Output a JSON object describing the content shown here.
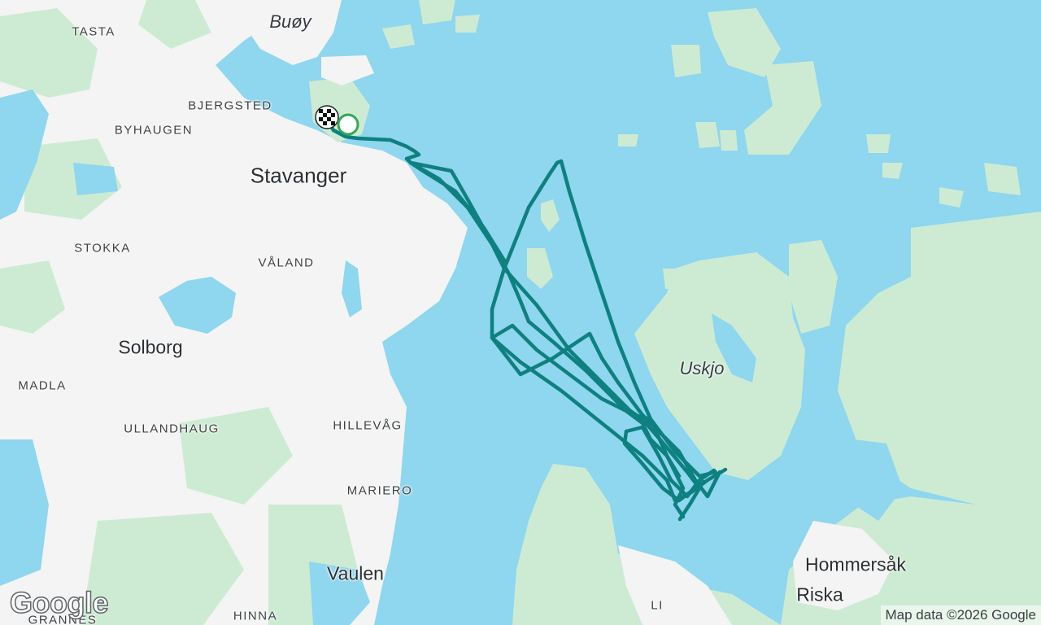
{
  "map": {
    "labels": {
      "tasta": "TASTA",
      "buoy": "Buøy",
      "bjergsted": "BJERGSTED",
      "byhaugen": "BYHAUGEN",
      "stavanger": "Stavanger",
      "stokka": "STOKKA",
      "valand": "VÅLAND",
      "solborg": "Solborg",
      "madla": "MADLA",
      "ullandhaug": "ULLANDHAUG",
      "hillevag": "HILLEVÅG",
      "mariero": "MARIERO",
      "vaulen": "Vaulen",
      "hinna": "HINNA",
      "gausel": "GRANNES",
      "uskjo": "Uskjo",
      "hommersak": "Hommersåk",
      "riska": "Riska",
      "li": "LI"
    },
    "logo": "Google",
    "attribution": "Map data ©2026 Google",
    "colors": {
      "water": "#8fd6ef",
      "land": "#f5f5f5",
      "green": "#c8ebcf",
      "route": "#0e8080",
      "start_marker": "#34a853"
    },
    "markers": {
      "start": "start-circle-icon",
      "finish": "checkered-flag-icon"
    }
  }
}
